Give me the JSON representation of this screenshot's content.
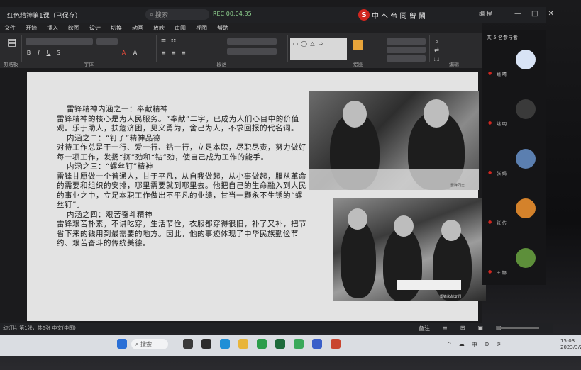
{
  "titlebar": {
    "doc_title": "红色精神第1课（已保存）",
    "search_placeholder": "搜索",
    "recording": "REC 00:04:35",
    "brand_text": "中 ヘ 帝 同 曾 鬧",
    "user": "编 程",
    "window_buttons": [
      "—",
      "□",
      "✕"
    ]
  },
  "ribbon": {
    "tabs": [
      "文件",
      "开始",
      "插入",
      "绘图",
      "设计",
      "切换",
      "动画",
      "放映",
      "审阅",
      "视图",
      "帮助"
    ],
    "group_captions": [
      "剪贴板",
      "字体",
      "段落",
      "绘图",
      "编辑"
    ],
    "icons": [
      "paste-icon",
      "bold-icon",
      "italic-icon",
      "underline-icon",
      "font-color-icon",
      "align-left-icon",
      "align-center-icon",
      "shapes-icon",
      "find-icon",
      "replace-icon",
      "select-icon"
    ]
  },
  "slide": {
    "paragraphs": [
      "雷锋精神内涵之一：奉献精神",
      "雷锋精神的核心是为人民服务。“奉献”二字，已成为人们心目中的价值观。乐于助人，扶危济困，见义勇为，舍己为人，不求回报的代名词。",
      "内涵之二：“钉子”精神品德",
      "对待工作总是干一行、爱一行、钻一行，立足本职，尽职尽责，努力做好每一项工作，发扬“挤”劲和“钻”劲，使自己成为工作的能手。",
      "内涵之三：“螺丝钉”精神",
      "雷锋甘愿做一个普通人，甘于平凡，从自我做起，从小事做起，服从革命的需要和组织的安排，哪里需要就到哪里去。他把自己的生命融入到人民的事业之中，立足本职工作做出不平凡的业绩，甘当一颗永不生锈的“螺丝钉”。",
      "内涵之四：艰苦奋斗精神",
      "雷锋艰苦朴素，不讲吃穿，生活节俭，衣服都穿得很旧，补了又补，把节省下来的钱用到最需要的地方。因此，他的事迹体现了中华民族勤俭节约、艰苦奋斗的传统美德。"
    ],
    "photo1_caption": "雷锋同志",
    "photo2_caption": "雷锋和战友们"
  },
  "participants": {
    "header": "共 5 名参与者",
    "items": [
      {
        "name": "姚 晴",
        "avatar_color": "#d8e3f5"
      },
      {
        "name": "姚 明",
        "avatar_color": "#3a3a3a"
      },
      {
        "name": "张 娟",
        "avatar_color": "#5b7fb0"
      },
      {
        "name": "张 仿",
        "avatar_color": "#d4822b"
      },
      {
        "name": "王 娜",
        "avatar_color": "#5d8f3a"
      }
    ]
  },
  "status": {
    "left": "幻灯片 第1张，共6张 中文(中国)",
    "right_items": [
      "备注",
      "≡",
      "⊞",
      "▣",
      "▤"
    ]
  },
  "taskbar": {
    "search": "搜索",
    "clock_time": "15:03",
    "clock_date": "2023/3/2",
    "tray": [
      "^",
      "☁",
      "中",
      "⊕",
      "⚞"
    ]
  },
  "colors": {
    "accent_red": "#d0261f",
    "ribbon_bg": "#2b2b2d",
    "slide_bg": "#e3e3e3",
    "taskbar_bg": "#dadde2"
  }
}
